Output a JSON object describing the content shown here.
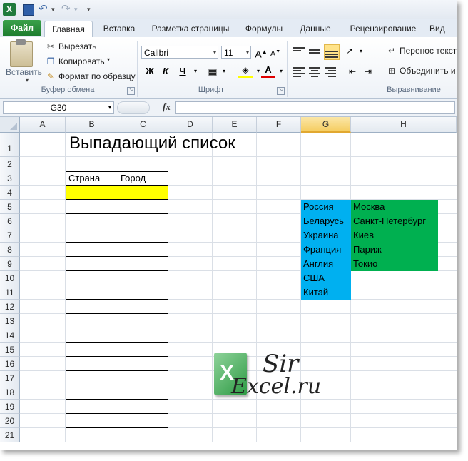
{
  "qat": {
    "logo": "X",
    "undo_icon": "undo-icon",
    "redo_icon": "redo-icon"
  },
  "tabs": [
    "Файл",
    "Главная",
    "Вставка",
    "Разметка страницы",
    "Формулы",
    "Данные",
    "Рецензирование",
    "Вид"
  ],
  "active_tab": "Главная",
  "ribbon": {
    "clipboard": {
      "paste": "Вставить",
      "cut": "Вырезать",
      "copy": "Копировать",
      "format_painter": "Формат по образцу",
      "group": "Буфер обмена"
    },
    "font": {
      "name": "Calibri",
      "size": "11",
      "bold": "Ж",
      "italic": "К",
      "underline": "Ч",
      "group": "Шрифт"
    },
    "alignment": {
      "wrap": "Перенос текст",
      "merge": "Объединить и",
      "group": "Выравнивание"
    }
  },
  "formula_bar": {
    "name_box": "G30",
    "fx": "fx",
    "value": ""
  },
  "columns": [
    "A",
    "B",
    "C",
    "D",
    "E",
    "F",
    "G",
    "H"
  ],
  "selected_column": "G",
  "rows": [
    "1",
    "2",
    "3",
    "4",
    "5",
    "6",
    "7",
    "8",
    "9",
    "10",
    "11",
    "12",
    "13",
    "14",
    "15",
    "16",
    "17",
    "18",
    "19",
    "20",
    "21"
  ],
  "sheet": {
    "title": "Выпадающий список",
    "headers": {
      "country": "Страна",
      "city": "Город"
    },
    "countries": [
      "Россия",
      "Беларусь",
      "Украина",
      "Франция",
      "Англия",
      "США",
      "Китай"
    ],
    "cities": [
      "Москва",
      "Санкт-Петербург",
      "Киев",
      "Париж",
      "Токио"
    ]
  },
  "watermark": {
    "line1": "Sir",
    "line2": "Excel.ru",
    "logo": "X"
  },
  "colors": {
    "yellow": "#ffff00",
    "blue": "#00b0f0",
    "green": "#00b050",
    "selected_header": "#f5cd61"
  }
}
